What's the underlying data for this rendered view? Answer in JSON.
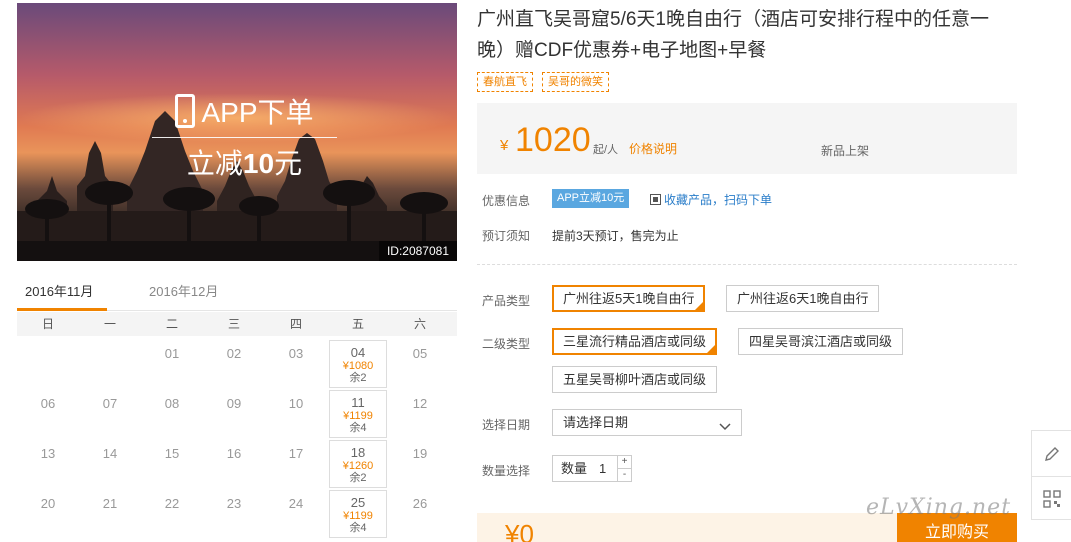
{
  "hero": {
    "promo_line1": "APP下单",
    "promo_line2_prefix": "立减",
    "promo_line2_amount": "10",
    "promo_line2_suffix": "元",
    "id_tag": "ID:2087081"
  },
  "calendar": {
    "tabs": [
      {
        "label": "2016年11月",
        "active": true
      },
      {
        "label": "2016年12月",
        "active": false
      }
    ],
    "weekdays": [
      "日",
      "一",
      "二",
      "三",
      "四",
      "五",
      "六"
    ],
    "weeks": [
      [
        "",
        "",
        "01",
        "02",
        "03",
        "04",
        "05"
      ],
      [
        "06",
        "07",
        "08",
        "09",
        "10",
        "11",
        "12"
      ],
      [
        "13",
        "14",
        "15",
        "16",
        "17",
        "18",
        "19"
      ],
      [
        "20",
        "21",
        "22",
        "23",
        "24",
        "25",
        "26"
      ]
    ],
    "available": [
      {
        "day": "04",
        "price": "¥1080",
        "remain": "余2"
      },
      {
        "day": "11",
        "price": "¥1199",
        "remain": "余4"
      },
      {
        "day": "18",
        "price": "¥1260",
        "remain": "余2"
      },
      {
        "day": "25",
        "price": "¥1199",
        "remain": "余4"
      }
    ]
  },
  "product": {
    "title": "广州直飞吴哥窟5/6天1晚自由行（酒店可安排行程中的任意一晚）赠CDF优惠券+电子地图+早餐",
    "tags": [
      "春航直飞",
      "吴哥的微笑"
    ],
    "price": {
      "yen": "¥",
      "amount": "1020",
      "unit": "起/人",
      "explain": "价格说明",
      "status": "新品上架"
    },
    "discount_label": "优惠信息",
    "app_badge": "APP立减10元",
    "qr_link": "收藏产品，扫码下单",
    "booking_label": "预订须知",
    "booking_text": "提前3天预订，售完为止",
    "type_label": "产品类型",
    "types": [
      {
        "label": "广州往返5天1晚自由行",
        "selected": true
      },
      {
        "label": "广州往返6天1晚自由行",
        "selected": false
      }
    ],
    "level2_label": "二级类型",
    "level2": [
      {
        "label": "三星流行精品酒店或同级",
        "selected": true
      },
      {
        "label": "四星吴哥滨江酒店或同级",
        "selected": false
      },
      {
        "label": "五星吴哥柳叶酒店或同级",
        "selected": false
      }
    ],
    "date_label": "选择日期",
    "date_placeholder": "请选择日期",
    "qty_label": "数量选择",
    "qty_prefix": "数量",
    "qty_value": "1",
    "qty_plus": "+",
    "qty_minus": "-",
    "total_price": "¥0",
    "buy_button": "立即购买"
  },
  "watermark": "eLvXing.net"
}
